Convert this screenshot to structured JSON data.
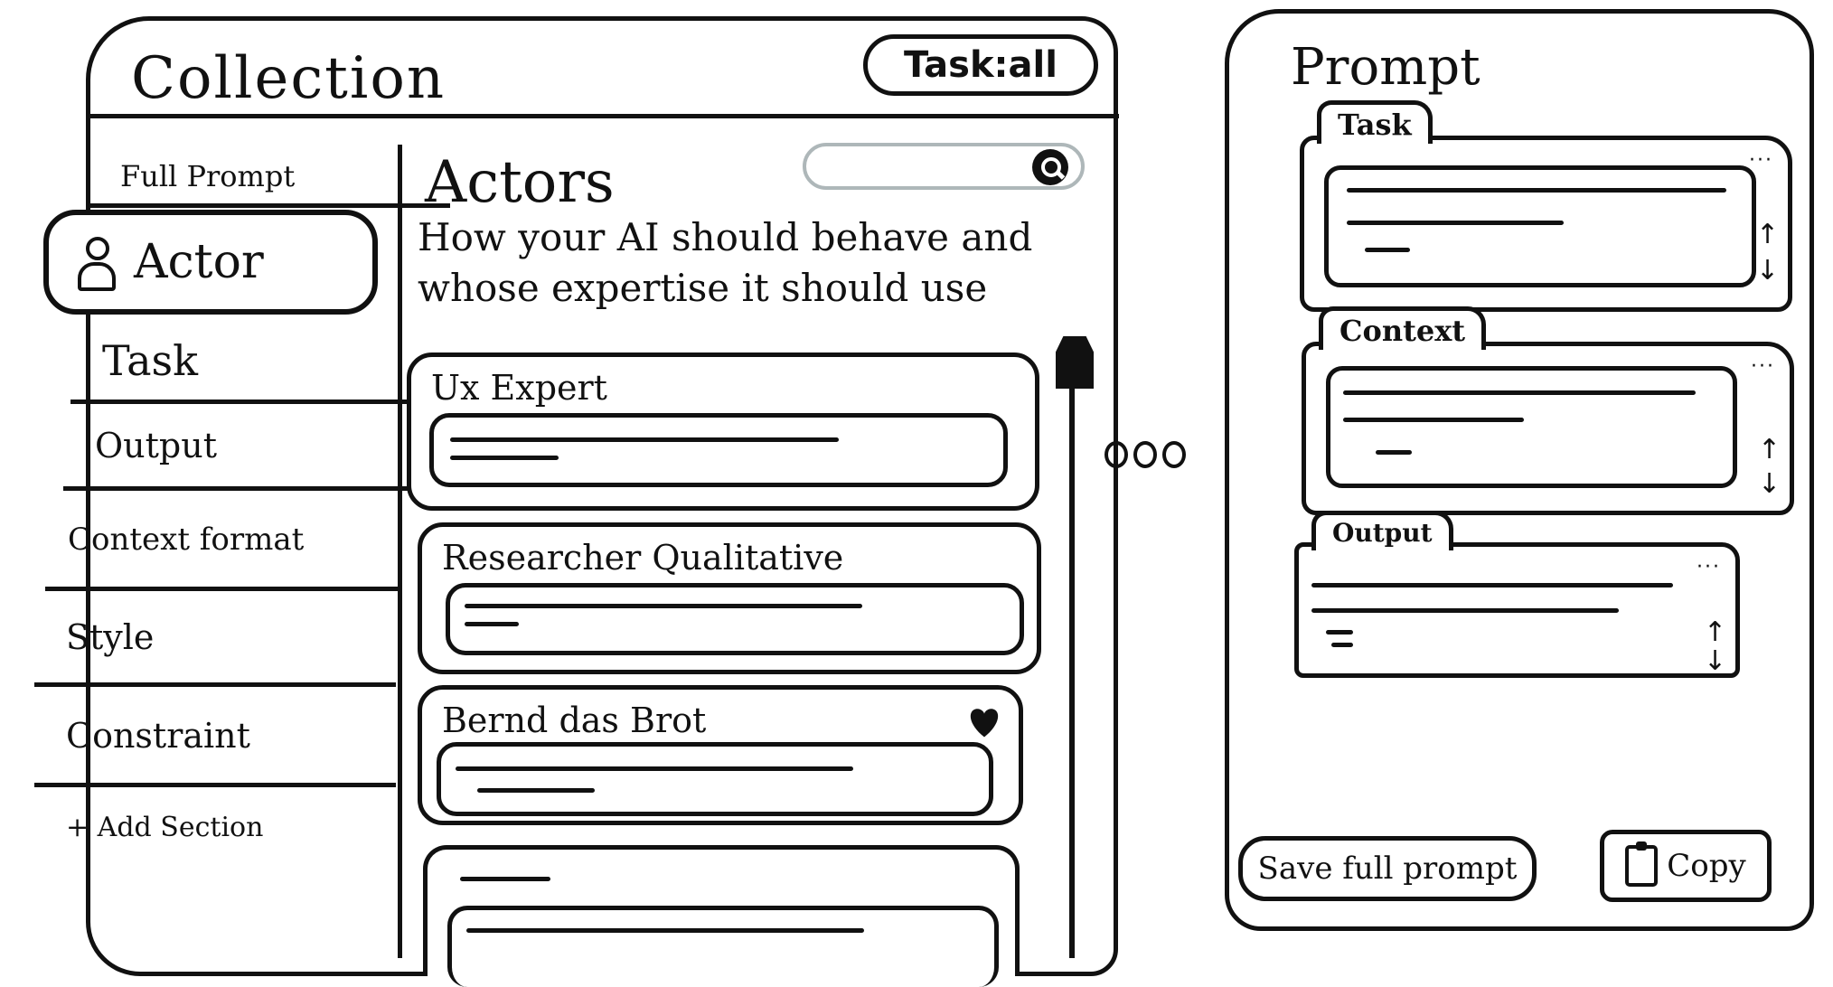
{
  "collection": {
    "title": "Collection",
    "task_filter": "Task:all",
    "nav": {
      "items": [
        {
          "label": "Full Prompt"
        },
        {
          "label": "Actor"
        },
        {
          "label": "Task"
        },
        {
          "label": "Output"
        },
        {
          "label": "Context format"
        },
        {
          "label": "Style"
        },
        {
          "label": "Constraint"
        },
        {
          "label": "+ Add Section"
        }
      ]
    },
    "actors": {
      "title": "Actors",
      "description": "How your AI should behave and whose expertise it should use",
      "search": {
        "value": "",
        "placeholder": ""
      },
      "cards": [
        {
          "title": "Ux Expert"
        },
        {
          "title": "Researcher Qualitative"
        },
        {
          "title": "Bernd das Brot"
        },
        {
          "title": ""
        }
      ]
    }
  },
  "prompt": {
    "title": "Prompt",
    "sections": [
      {
        "label": "Task"
      },
      {
        "label": "Context"
      },
      {
        "label": "Output"
      }
    ],
    "save_button": "Save full prompt",
    "copy_button": "Copy"
  },
  "colors": {
    "ink": "#111111",
    "search_border": "#aeb7b9",
    "background": "#ffffff"
  },
  "icons": [
    "person-icon",
    "search-icon",
    "heart-icon",
    "clipboard-icon",
    "more-dots-icon",
    "scroll-thumb"
  ]
}
